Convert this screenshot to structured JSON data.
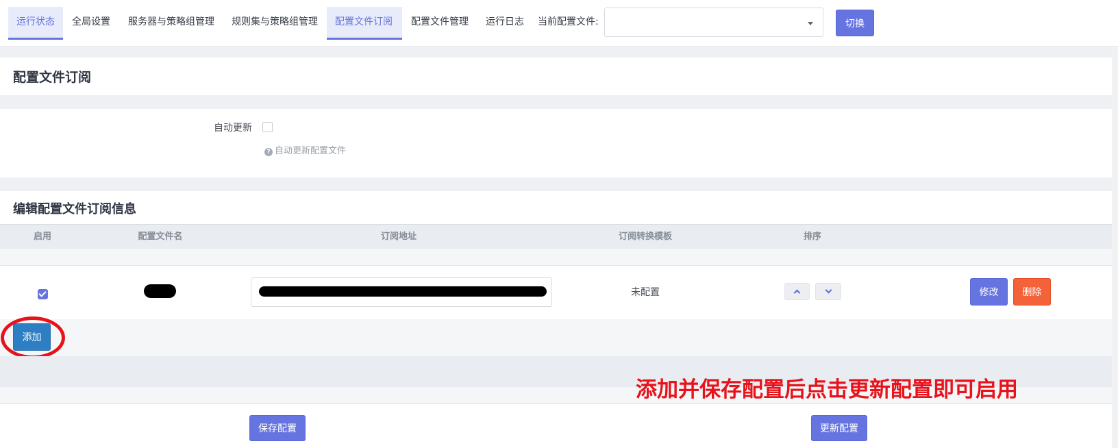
{
  "nav": {
    "tabs": [
      {
        "label": "运行状态",
        "active": true
      },
      {
        "label": "全局设置",
        "active": false
      },
      {
        "label": "服务器与策略组管理",
        "active": false
      },
      {
        "label": "规则集与策略组管理",
        "active": false
      },
      {
        "label": "配置文件订阅",
        "active": true
      },
      {
        "label": "配置文件管理",
        "active": false
      },
      {
        "label": "运行日志",
        "active": false
      }
    ],
    "current_profile_label": "当前配置文件:",
    "current_profile_value": "",
    "switch_button": "切换"
  },
  "page_title": "配置文件订阅",
  "auto_update": {
    "label": "自动更新",
    "checked": false,
    "hint": "自动更新配置文件"
  },
  "subscriptions": {
    "title": "编辑配置文件订阅信息",
    "columns": [
      "启用",
      "配置文件名",
      "订阅地址",
      "订阅转换模板",
      "排序"
    ],
    "rows": [
      {
        "enabled": true,
        "name_redacted": true,
        "url_redacted": true,
        "template": "未配置",
        "edit_button": "修改",
        "delete_button": "删除"
      }
    ],
    "add_button": "添加"
  },
  "annotation": "添加并保存配置后点击更新配置即可启用",
  "footer": {
    "save_button": "保存配置",
    "update_button": "更新配置"
  },
  "colors": {
    "accent": "#6574e0",
    "danger": "#f4623a",
    "add_button": "#2e7ec4",
    "annotation_red": "#e8121b"
  },
  "icons": [
    "dropdown-caret-icon",
    "help-circle-icon",
    "checkmark-icon",
    "chevron-up-icon",
    "chevron-down-icon"
  ]
}
